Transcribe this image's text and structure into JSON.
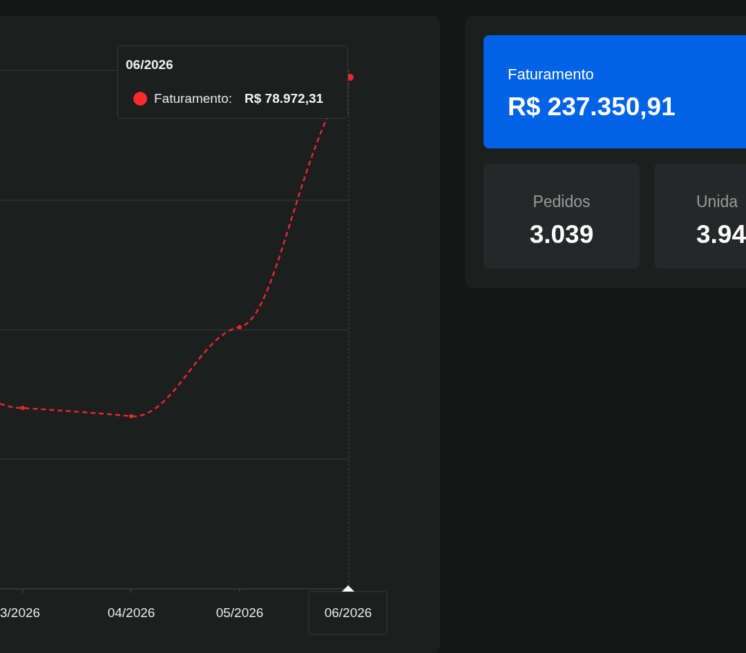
{
  "chart": {
    "x_labels": [
      {
        "label": "3/2026",
        "hovered": false
      },
      {
        "label": "04/2026",
        "hovered": false
      },
      {
        "label": "05/2026",
        "hovered": false
      },
      {
        "label": "06/2026",
        "hovered": true
      }
    ],
    "tooltip": {
      "title": "06/2026",
      "series": "Faturamento:",
      "value": "R$ 78.972,31"
    }
  },
  "summary": {
    "main": {
      "label": "Faturamento",
      "value": "R$ 237.350,91"
    },
    "cards": [
      {
        "label": "Pedidos",
        "value": "3.039"
      },
      {
        "label": "Unida",
        "value": "3.94"
      }
    ]
  }
}
